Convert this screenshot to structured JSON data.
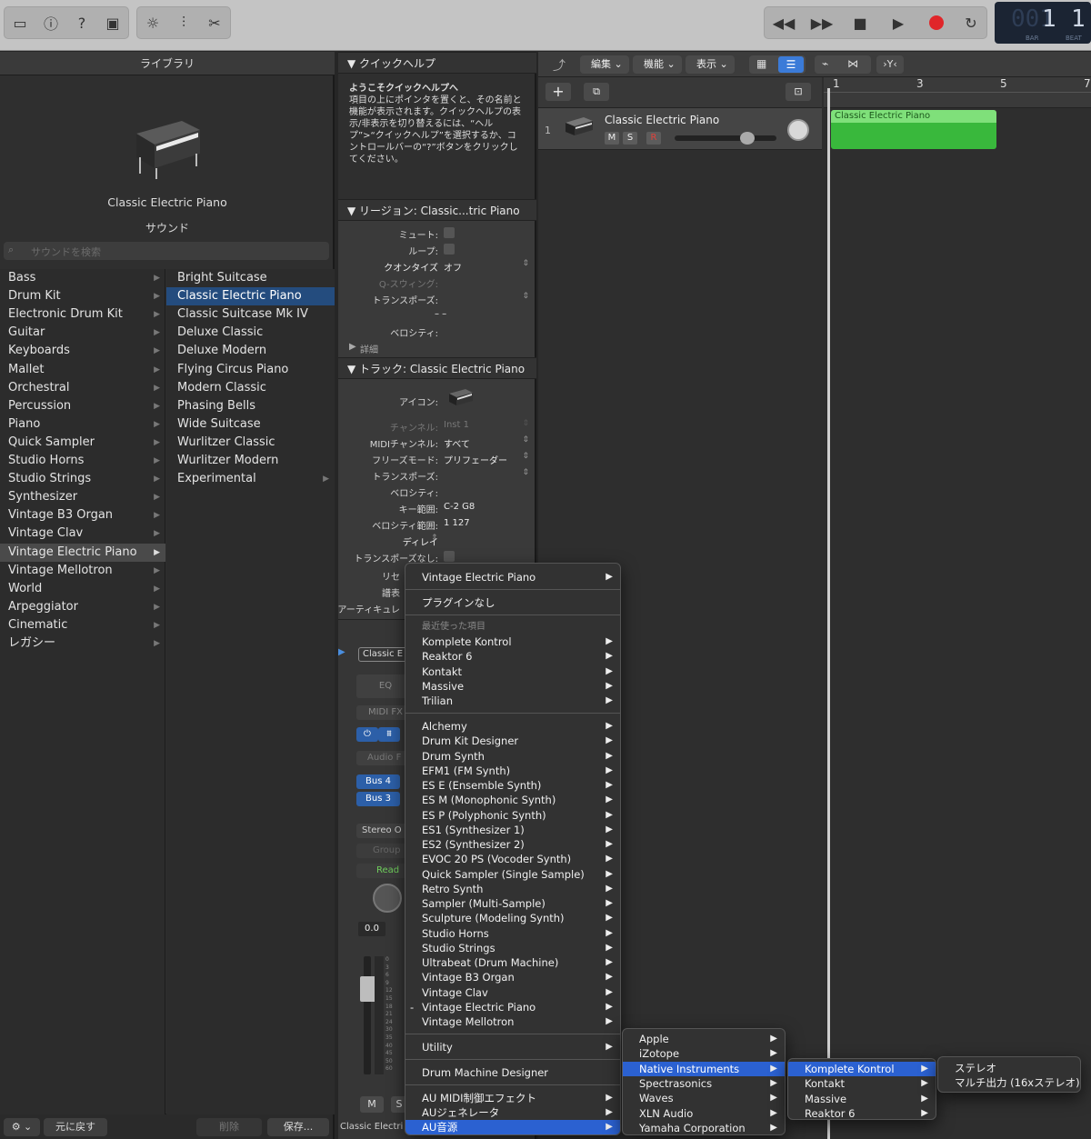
{
  "toolbar": {
    "left_buttons": [
      "inbox-icon",
      "info-icon",
      "help-icon",
      "editor-icon"
    ],
    "mid_buttons": [
      "brightness-icon",
      "mixer-icon",
      "scissors-icon"
    ],
    "transport": [
      "rewind-icon",
      "forward-icon",
      "stop-icon",
      "play-icon",
      "record-icon",
      "cycle-icon"
    ],
    "lcd": {
      "bar_digits": "001",
      "bar_value": "1",
      "beat_value": "1",
      "bar_label": "BAR",
      "beat_label": "BEAT"
    }
  },
  "library": {
    "title": "ライブラリ",
    "preview_name": "Classic Electric Piano",
    "section": "サウンド",
    "search_placeholder": "サウンドを検索",
    "categories": [
      "Bass",
      "Drum Kit",
      "Electronic Drum Kit",
      "Guitar",
      "Keyboards",
      "Mallet",
      "Orchestral",
      "Percussion",
      "Piano",
      "Quick Sampler",
      "Studio Horns",
      "Studio Strings",
      "Synthesizer",
      "Vintage B3 Organ",
      "Vintage Clav",
      "Vintage Electric Piano",
      "Vintage Mellotron",
      "World",
      "Arpeggiator",
      "Cinematic",
      "レガシー"
    ],
    "selected_category": "Vintage Electric Piano",
    "patches": [
      "Bright Suitcase",
      "Classic Electric Piano",
      "Classic Suitcase Mk IV",
      "Deluxe Classic",
      "Deluxe Modern",
      "Flying Circus Piano",
      "Modern Classic",
      "Phasing Bells",
      "Wide Suitcase",
      "Wurlitzer Classic",
      "Wurlitzer Modern",
      "Experimental"
    ],
    "selected_patch": "Classic Electric Piano",
    "footer": {
      "revert": "元に戻す",
      "delete": "削除",
      "save": "保存..."
    }
  },
  "quickhelp": {
    "title": "クイックヘルプ",
    "heading": "ようこそクイックヘルプへ",
    "body": "項目の上にポインタを置くと、その名前と機能が表示されます。クイックヘルプの表示/非表示を切り替えるには、“ヘルプ”>“クイックヘルプ”を選択するか、コントロールバーの“?”ボタンをクリックしてください。"
  },
  "region_inspector": {
    "title": "リージョン: Classic...tric Piano",
    "mute": "ミュート:",
    "loop": "ループ:",
    "quantize_label": "クオンタイズ",
    "quantize_value": "オフ",
    "qswing": "Q-スウィング:",
    "transpose": "トランスポーズ:",
    "dashes": "– –",
    "velocity": "ベロシティ:",
    "more": "詳細"
  },
  "track_inspector": {
    "title": "トラック: Classic Electric Piano",
    "icon": "アイコン:",
    "channel_label": "チャンネル:",
    "channel_value": "Inst 1",
    "midi_channel_label": "MIDIチャンネル:",
    "midi_channel_value": "すべて",
    "freeze_label": "フリーズモード:",
    "freeze_value": "プリフェーダー",
    "transpose": "トランスポーズ:",
    "velocity": "ベロシティ:",
    "key_range_label": "キー範囲:",
    "key_range_value": "C-2  G8",
    "vel_range_label": "ベロシティ範囲:",
    "vel_range_value": "1  127",
    "delay": "ディレイ",
    "no_transpose": "トランスポーズなし:",
    "reset_partial": "リセ",
    "display_partial": "譜表",
    "articulation_partial": "アーティキュレ"
  },
  "channel_strip": {
    "setting": "Classic E",
    "eq": "EQ",
    "midi_fx": "MIDI FX",
    "audio_fx": "Audio F",
    "bus4": "Bus 4",
    "bus3": "Bus 3",
    "output": "Stereo O",
    "group": "Group",
    "automation": "Read",
    "volume": "0.0",
    "meter_scale": [
      "0",
      "3",
      "6",
      "9",
      "12",
      "15",
      "18",
      "21",
      "24",
      "30",
      "35",
      "40",
      "45",
      "50",
      "60"
    ],
    "mute": "M",
    "solo": "S",
    "name": "Classic Electri"
  },
  "tracks": {
    "menus": [
      "編集",
      "機能",
      "表示"
    ],
    "track_number": "1",
    "track_name": "Classic Electric Piano",
    "mute": "M",
    "solo": "S",
    "record": "R",
    "ruler": [
      "1",
      "3",
      "5",
      "7"
    ],
    "region_name": "Classic Electric Piano",
    "region_color": "#39b83c",
    "region_header_color": "#7fe07a"
  },
  "plugin_menu": {
    "top_item": "Vintage Electric Piano",
    "no_plugin": "プラグインなし",
    "recent_header": "最近使った項目",
    "recent": [
      "Komplete Kontrol",
      "Reaktor 6",
      "Kontakt",
      "Massive",
      "Trilian"
    ],
    "instruments": [
      "Alchemy",
      "Drum Kit Designer",
      "Drum Synth",
      "EFM1  (FM Synth)",
      "ES E  (Ensemble Synth)",
      "ES M  (Monophonic Synth)",
      "ES P  (Polyphonic Synth)",
      "ES1  (Synthesizer 1)",
      "ES2  (Synthesizer 2)",
      "EVOC 20 PS  (Vocoder Synth)",
      "Quick Sampler (Single Sample)",
      "Retro Synth",
      "Sampler (Multi-Sample)",
      "Sculpture  (Modeling Synth)",
      "Studio Horns",
      "Studio Strings",
      "Ultrabeat (Drum Machine)",
      "Vintage B3 Organ",
      "Vintage Clav",
      "Vintage Electric Piano",
      "Vintage Mellotron"
    ],
    "current_marker": "-",
    "utility": "Utility",
    "drum_machine": "Drum Machine Designer",
    "au_midi": "AU MIDI制御エフェクト",
    "au_generator": "AUジェネレータ",
    "au_instruments": "AU音源"
  },
  "vendor_menu": [
    "Apple",
    "iZotope",
    "Native Instruments",
    "Spectrasonics",
    "Waves",
    "XLN Audio",
    "Yamaha Corporation"
  ],
  "ni_menu": [
    "Komplete Kontrol",
    "Kontakt",
    "Massive",
    "Reaktor 6"
  ],
  "kk_menu": [
    "ステレオ",
    "マルチ出力 (16xステレオ)"
  ]
}
